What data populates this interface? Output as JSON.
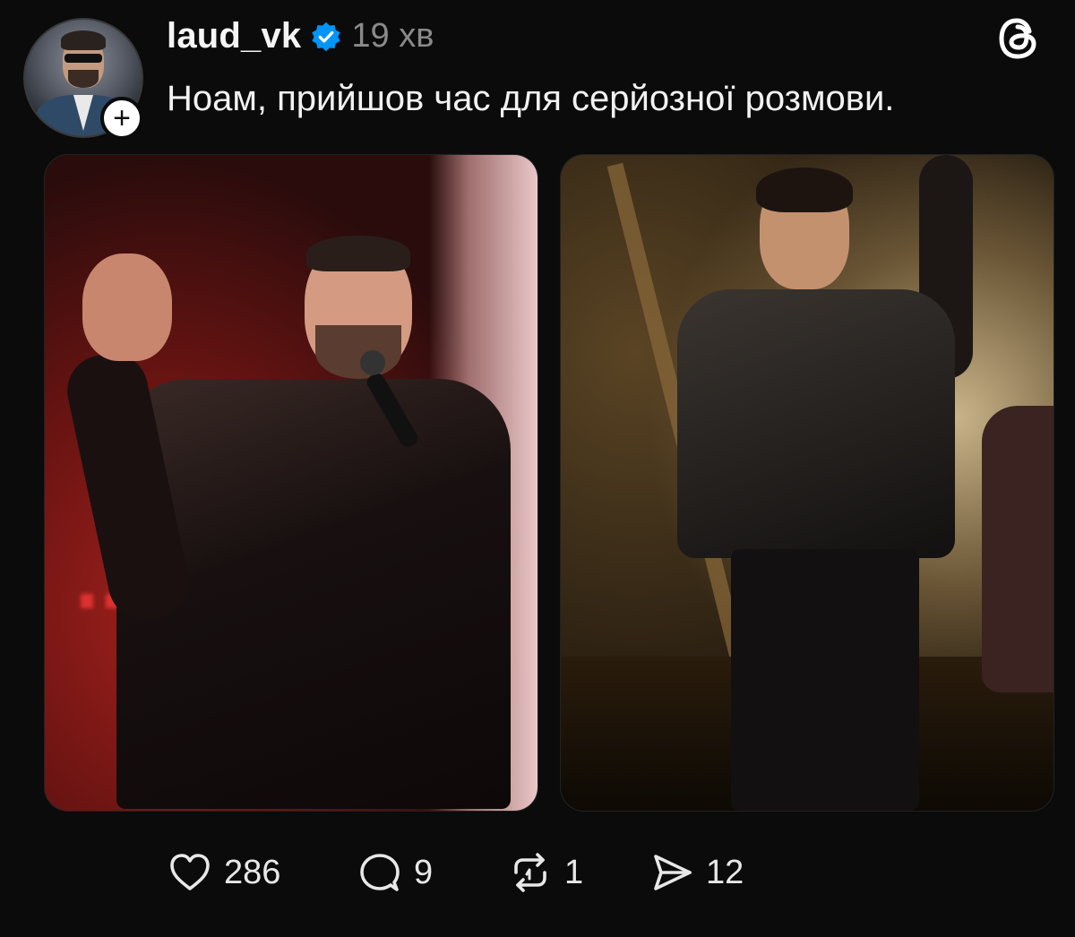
{
  "post": {
    "username": "laud_vk",
    "time": "19 хв",
    "text": "Ноам, прийшов час для серйозної розмови.",
    "verified_color": "#0095f6",
    "avatar_add_symbol": "+",
    "app_icon": "threads-icon"
  },
  "actions": {
    "likes": "286",
    "replies": "9",
    "reposts": "1",
    "shares": "12"
  }
}
